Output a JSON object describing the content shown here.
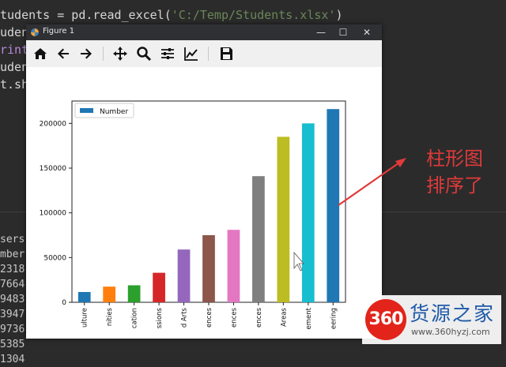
{
  "editor": {
    "code_lines": [
      {
        "pre": "tudents = pd.read_excel(",
        "str": "'C:/Temp/Students.xlsx'",
        "post": ")",
        "purp": ""
      },
      {
        "pre": "uden",
        "str": "",
        "post": "",
        "purp": ""
      },
      {
        "pre": "",
        "str": "",
        "post": "(",
        "purp": "rint"
      },
      {
        "pre": "uden",
        "str": "",
        "post": "",
        "purp": ""
      },
      {
        "pre": "t.sho",
        "str": "",
        "post": "",
        "purp": ""
      }
    ],
    "output_lines": [
      "sers",
      "mber",
      "2318",
      "7664",
      "9483",
      "3947",
      "9736",
      "5385",
      "1304"
    ]
  },
  "window": {
    "title": "Figure 1",
    "minimize": "—",
    "maximize": "☐",
    "close": "✕"
  },
  "toolbar": {
    "buttons": [
      "home-icon",
      "back-icon",
      "forward-icon",
      "pan-icon",
      "zoom-icon",
      "configure-subplots-icon",
      "edit-axis-icon",
      "save-icon"
    ]
  },
  "chart_data": {
    "type": "bar",
    "categories": [
      "ulture",
      "nities",
      "cation",
      "ssions",
      "d Arts",
      "ences",
      "ences",
      "ences",
      "Areas",
      "ement",
      "eering"
    ],
    "values": [
      11500,
      17500,
      19000,
      33000,
      59000,
      75000,
      81000,
      141000,
      185000,
      200000,
      216000
    ],
    "series": [
      {
        "name": "Number"
      }
    ],
    "bar_colors": [
      "#1f77b4",
      "#ff7f0e",
      "#2ca02c",
      "#d62728",
      "#9467bd",
      "#8c564b",
      "#e377c2",
      "#7f7f7f",
      "#bcbd22",
      "#17becf",
      "#1f77b4"
    ],
    "yticks": [
      0,
      50000,
      100000,
      150000,
      200000
    ],
    "ylim": [
      0,
      225000
    ],
    "legend": "top-left",
    "grid": false
  },
  "annotation": {
    "line1": "柱形图",
    "line2": "排序了",
    "color": "#e03a3a"
  },
  "watermark": {
    "badge": "360",
    "name": "货源之家",
    "url": "www.360hyzj.com"
  }
}
